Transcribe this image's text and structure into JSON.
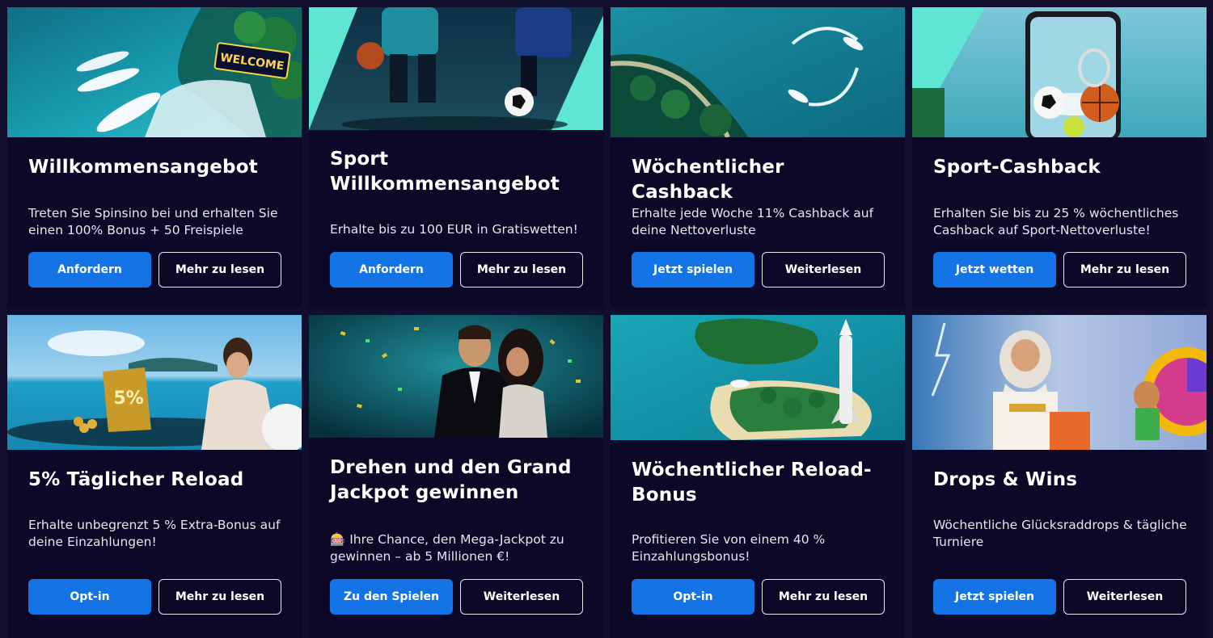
{
  "colors": {
    "page_bg": "#110e2d",
    "card_bg": "#0b0828",
    "primary_button": "#1474e6",
    "accent_teal": "#5fe6d2"
  },
  "cards": [
    {
      "title": "Willkommensangebot",
      "description": "Treten Sie Spinsino bei und erhalten Sie einen 100% Bonus + 50 Freispiele",
      "primary_label": "Anfordern",
      "secondary_label": "Mehr zu lesen",
      "image_sign_text": "WELCOME",
      "image": "yachts-welcome-sign-island"
    },
    {
      "title": "Sport Willkommensangebot",
      "description": "Erhalte bis zu 100 EUR in Gratiswetten!",
      "primary_label": "Anfordern",
      "secondary_label": "Mehr zu lesen",
      "image": "football-basketball-players"
    },
    {
      "title": "Wöchentlicher Cashback",
      "description": "Erhalte jede Woche 11% Cashback auf deine Nettoverluste",
      "primary_label": "Jetzt spielen",
      "secondary_label": "Weiterlesen",
      "image": "boats-circling-ocean"
    },
    {
      "title": "Sport-Cashback",
      "description": "Erhalten Sie bis zu 25 % wöchentliches Cashback auf Sport-Nettoverluste!",
      "primary_label": "Jetzt wetten",
      "secondary_label": "Mehr zu lesen",
      "image": "phone-with-sport-balls"
    },
    {
      "title": "5% Täglicher Reload",
      "description": "Erhalte unbegrenzt 5 % Extra-Bonus auf deine Einzahlungen!",
      "primary_label": "Opt-in",
      "secondary_label": "Mehr zu lesen",
      "image_sign_text": "5%",
      "image": "woman-pool-gold-coins"
    },
    {
      "title": "Drehen und den Grand Jackpot gewinnen",
      "description": "🎰 Ihre Chance, den Mega-Jackpot zu gewinnen – ab 5 Millionen €!",
      "primary_label": "Zu den Spielen",
      "secondary_label": "Weiterlesen",
      "image": "couple-confetti"
    },
    {
      "title": "Wöchentlicher Reload-Bonus",
      "description": "Profitieren Sie von einem 40 % Einzahlungsbonus!",
      "primary_label": "Opt-in",
      "secondary_label": "Mehr zu lesen",
      "image": "island-rocket"
    },
    {
      "title": "Drops & Wins",
      "description": "Wöchentliche Glücksraddrops & tägliche Turniere",
      "primary_label": "Jetzt spielen",
      "secondary_label": "Weiterlesen",
      "image": "zeus-lightning-wheel"
    }
  ]
}
